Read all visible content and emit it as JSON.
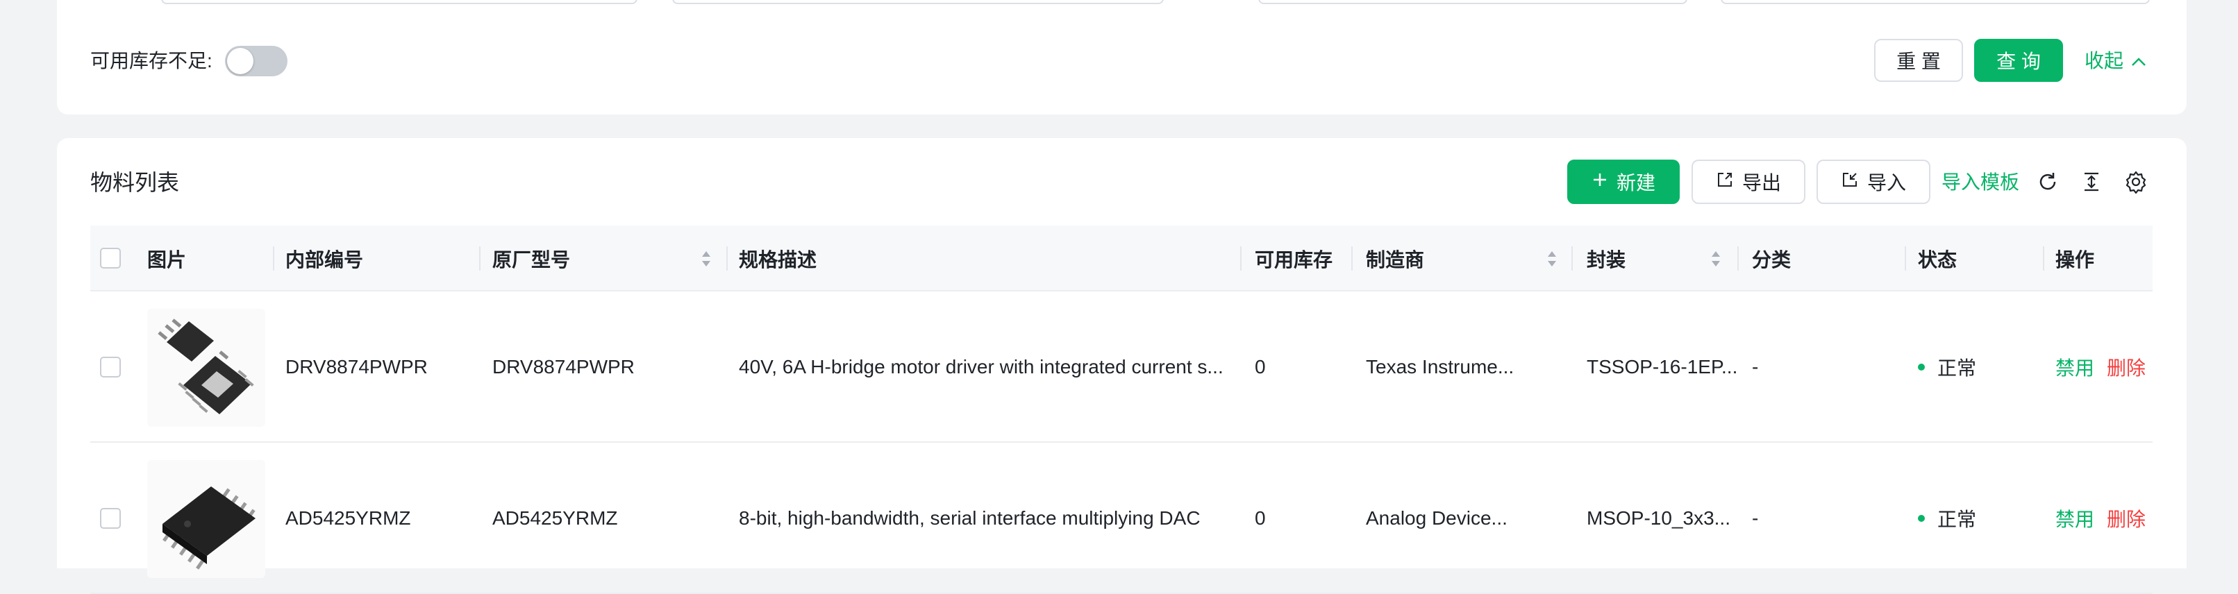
{
  "filter": {
    "stock_label": "可用库存不足:",
    "reset_label": "重 置",
    "search_label": "查 询",
    "collapse_label": "收起"
  },
  "list": {
    "title": "物料列表",
    "new_label": "新建",
    "export_label": "导出",
    "import_label": "导入",
    "template_label": "导入模板"
  },
  "table": {
    "columns": {
      "image": "图片",
      "internal_no": "内部编号",
      "mfr_part": "原厂型号",
      "spec": "规格描述",
      "stock": "可用库存",
      "manufacturer": "制造商",
      "package": "封装",
      "category": "分类",
      "status": "状态",
      "actions": "操作"
    },
    "rows": [
      {
        "internal_no": "DRV8874PWPR",
        "mfr_part": "DRV8874PWPR",
        "spec": "40V, 6A H-bridge motor driver with integrated current s...",
        "stock": "0",
        "manufacturer": "Texas Instrume...",
        "package": "TSSOP-16-1EP...",
        "category": "-",
        "status": "正常",
        "disable_label": "禁用",
        "delete_label": "删除"
      },
      {
        "internal_no": "AD5425YRMZ",
        "mfr_part": "AD5425YRMZ",
        "spec": "8-bit, high-bandwidth, serial interface multiplying DAC",
        "stock": "0",
        "manufacturer": "Analog Device...",
        "package": "MSOP-10_3x3...",
        "category": "-",
        "status": "正常",
        "disable_label": "禁用",
        "delete_label": "删除"
      }
    ]
  },
  "colors": {
    "primary": "#07b467",
    "danger": "#f53f3f",
    "page_bg": "#f2f3f5"
  }
}
